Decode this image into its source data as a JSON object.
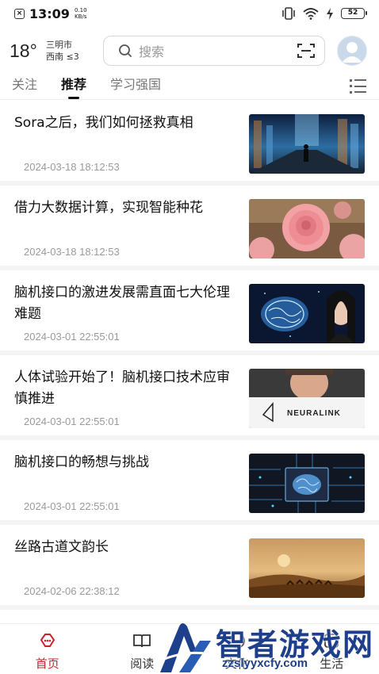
{
  "status_bar": {
    "time": "13:09",
    "net_speed_value": "0.10",
    "net_speed_unit": "KB/s",
    "battery": "52"
  },
  "header": {
    "temperature": "18°",
    "city": "三明市",
    "wind": "西南 ≤3",
    "search_placeholder": "搜索"
  },
  "tabs": [
    {
      "label": "关注",
      "active": false
    },
    {
      "label": "推荐",
      "active": true
    },
    {
      "label": "学习强国",
      "active": false
    }
  ],
  "news": [
    {
      "title": "Sora之后，我们如何拯救真相",
      "time": "2024-03-18 18:12:53",
      "thumb": "cyber-city"
    },
    {
      "title": "借力大数据计算，实现智能种花",
      "time": "2024-03-18 18:12:53",
      "thumb": "pink-roses"
    },
    {
      "title": "脑机接口的激进发展需直面七大伦理难题",
      "time": "2024-03-01 22:55:01",
      "thumb": "brain-woman"
    },
    {
      "title": "人体试验开始了！脑机接口技术应审慎推进",
      "time": "2024-03-01 22:55:01",
      "thumb": "neuralink"
    },
    {
      "title": "脑机接口的畅想与挑战",
      "time": "2024-03-01 22:55:01",
      "thumb": "chip-brain"
    },
    {
      "title": "丝路古道文韵长",
      "time": "2024-02-06 22:38:12",
      "thumb": "desert-camels"
    }
  ],
  "thumb_text": {
    "neuralink": "NEURALINK"
  },
  "bottom_nav": [
    {
      "label": "首页",
      "icon": "home-icon",
      "active": true
    },
    {
      "label": "阅读",
      "icon": "book-icon",
      "active": false
    },
    {
      "label": "文化",
      "icon": "culture-icon",
      "active": false
    },
    {
      "label": "生活",
      "icon": "life-icon",
      "active": false
    }
  ],
  "watermark": {
    "name": "智者游戏网",
    "url": "zzslyyxcfy.com"
  },
  "colors": {
    "accent": "#c8232c",
    "watermark": "#1d3f8c"
  }
}
